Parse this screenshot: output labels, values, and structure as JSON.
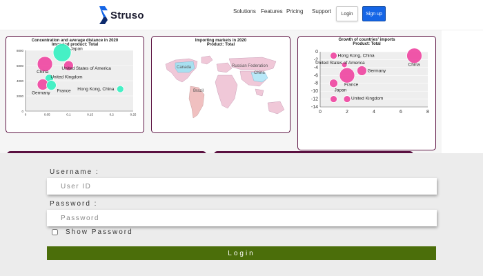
{
  "brand": {
    "name": "Struso",
    "color": "#1565e6"
  },
  "nav": {
    "items": [
      "Solutions",
      "Features",
      "Pricing",
      "Support"
    ]
  },
  "header_buttons": {
    "login": "Login",
    "signup": "Sign up"
  },
  "login_form": {
    "username_label": "Username :",
    "username_placeholder": "User ID",
    "password_label": "Password :",
    "password_placeholder": "Password",
    "show_password_label": "Show Password",
    "submit_label": "Login",
    "submit_color": "#4b6e0a"
  },
  "chart_data": [
    {
      "type": "scatter",
      "title": "Concentration and average distance in 2020",
      "subtitle": "Imported product: Total",
      "xlim": [
        0,
        0.25
      ],
      "ylim": [
        0,
        8000
      ],
      "xticks": [
        "0",
        "0.05",
        "0.1",
        "0.15",
        "0.2",
        "0.25"
      ],
      "yticks": [
        "0",
        "2000",
        "4000",
        "6000",
        "8000"
      ],
      "points": [
        {
          "label": "Japan",
          "x": 0.085,
          "y": 7700,
          "size": 13,
          "color": "#33f0c0"
        },
        {
          "label": "United States of America",
          "x": 0.1,
          "y": 6000,
          "size": 7,
          "color": "#ee44a0"
        },
        {
          "label": "China",
          "x": 0.045,
          "y": 6200,
          "size": 11,
          "color": "#ee44a0"
        },
        {
          "label": "United Kingdom",
          "x": 0.055,
          "y": 4300,
          "size": 6,
          "color": "#33f0c0"
        },
        {
          "label": "Germany",
          "x": 0.04,
          "y": 3500,
          "size": 8,
          "color": "#ee44a0"
        },
        {
          "label": "France",
          "x": 0.06,
          "y": 3400,
          "size": 7,
          "color": "#33f0c0"
        },
        {
          "label": "Hong Kong, China",
          "x": 0.22,
          "y": 2900,
          "size": 5,
          "color": "#33f0c0"
        }
      ]
    },
    {
      "type": "map",
      "title": "Importing markets in 2020",
      "subtitle": "Product: Total",
      "labels": [
        "Canada",
        "Russian Federation",
        "China",
        "Brazil"
      ]
    },
    {
      "type": "scatter",
      "title": "Growth of countries' imports",
      "subtitle": "Product: Total",
      "xlim": [
        0,
        8
      ],
      "ylim": [
        -14,
        0
      ],
      "xticks": [
        "0",
        "2",
        "4",
        "6",
        "8"
      ],
      "yticks": [
        "0",
        "-2",
        "-4",
        "-6",
        "-8",
        "-10",
        "-12",
        "-14"
      ],
      "points": [
        {
          "label": "Hong Kong, China",
          "x": 1,
          "y": -1,
          "size": 5,
          "color": "#ee44a0"
        },
        {
          "label": "China",
          "x": 7,
          "y": -1,
          "size": 11,
          "color": "#ee44a0"
        },
        {
          "label": "United States of America",
          "x": 1.8,
          "y": -3.3,
          "size": 4,
          "color": "#ee44a0"
        },
        {
          "label": "Germany",
          "x": 3.1,
          "y": -4.8,
          "size": 7,
          "color": "#ee44a0"
        },
        {
          "label": "France",
          "x": 2,
          "y": -6,
          "size": 11,
          "color": "#ee44a0"
        },
        {
          "label": "Japan",
          "x": 1,
          "y": -8,
          "size": 6,
          "color": "#ee44a0"
        },
        {
          "label": "United Kingdom",
          "x": 2,
          "y": -12,
          "size": 5,
          "color": "#ee44a0"
        },
        {
          "label": "",
          "x": 1,
          "y": -12,
          "size": 5,
          "color": "#ee44a0"
        }
      ]
    }
  ]
}
